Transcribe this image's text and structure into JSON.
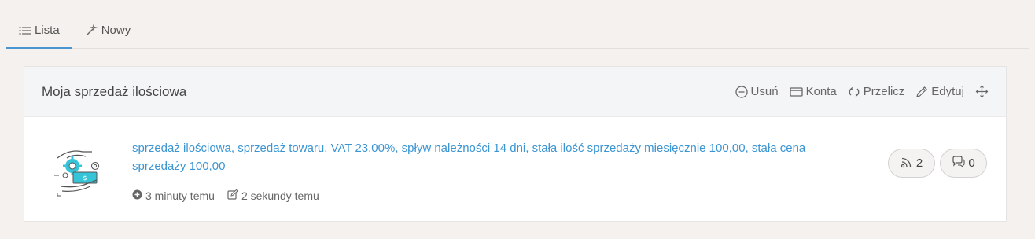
{
  "tabs": [
    {
      "label": "Lista",
      "icon": "list-icon",
      "active": true
    },
    {
      "label": "Nowy",
      "icon": "magic-wand-icon",
      "active": false
    }
  ],
  "panel": {
    "title": "Moja sprzedaż ilościowa",
    "actions": {
      "delete": "Usuń",
      "accounts": "Konta",
      "recalculate": "Przelicz",
      "edit": "Edytuj"
    }
  },
  "item": {
    "description": "sprzedaż ilościowa, sprzedaż towaru, VAT 23,00%, spływ należności 14 dni, stała ilość sprzedaży miesięcznie 100,00, stała cena sprzedaży 100,00",
    "created": "3 minuty temu",
    "modified": "2 sekundy temu",
    "feeds_count": "2",
    "comments_count": "0"
  },
  "colors": {
    "accent": "#4a96d2",
    "link": "#3b95d3",
    "background": "#f4f1ee"
  }
}
